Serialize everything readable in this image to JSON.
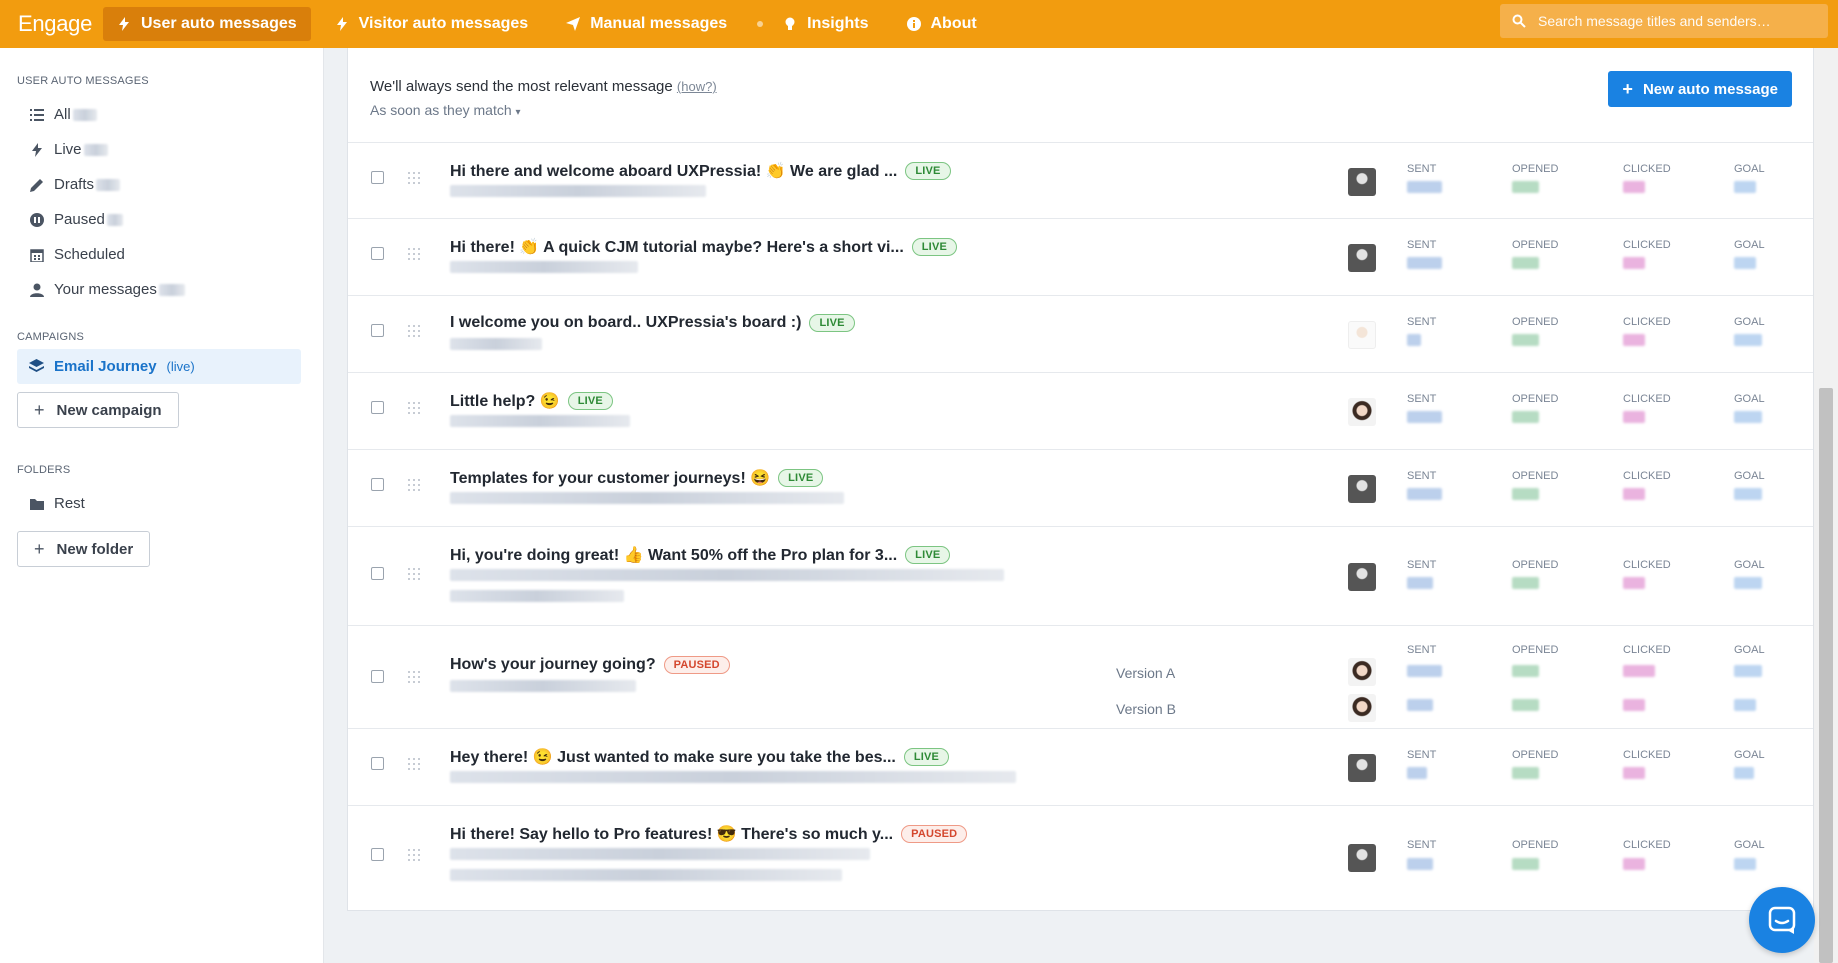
{
  "app": {
    "brand": "Engage"
  },
  "nav": {
    "items": [
      {
        "label": "User auto messages",
        "icon": "bolt-icon",
        "active": true
      },
      {
        "label": "Visitor auto messages",
        "icon": "bolt-icon",
        "active": false
      },
      {
        "label": "Manual messages",
        "icon": "paper-plane-icon",
        "active": false
      },
      {
        "label": "Insights",
        "icon": "lightbulb-icon",
        "active": false
      },
      {
        "label": "About",
        "icon": "info-icon",
        "active": false
      }
    ]
  },
  "search": {
    "placeholder": "Search message titles and senders…"
  },
  "sidebar": {
    "user_auto_heading": "USER AUTO MESSAGES",
    "items": [
      {
        "label": "All",
        "icon": "list-icon"
      },
      {
        "label": "Live",
        "icon": "bolt-icon"
      },
      {
        "label": "Drafts",
        "icon": "pencil-icon"
      },
      {
        "label": "Paused",
        "icon": "pause-icon"
      },
      {
        "label": "Scheduled",
        "icon": "calendar-icon"
      },
      {
        "label": "Your messages",
        "icon": "user-icon"
      }
    ],
    "campaigns_heading": "CAMPAIGNS",
    "campaign": {
      "name": "Email Journey",
      "status": "(live)"
    },
    "new_campaign": "New campaign",
    "folders_heading": "FOLDERS",
    "folder": {
      "label": "Rest"
    },
    "new_folder": "New folder"
  },
  "main": {
    "header_title": "We'll always send the most relevant message",
    "header_link": "(how?)",
    "header_sub": "As soon as they match",
    "new_button": "New auto message",
    "stat_labels": {
      "sent": "SENT",
      "opened": "OPENED",
      "clicked": "CLICKED",
      "goal": "GOAL"
    },
    "messages": [
      {
        "title": "Hi there and welcome aboard UXPressia! 👏 We are glad ...",
        "status": "LIVE"
      },
      {
        "title": "Hi there! 👏 A quick CJM tutorial maybe? Here's a short vi...",
        "status": "LIVE"
      },
      {
        "title": "I welcome you on board.. UXPressia's board :)",
        "status": "LIVE"
      },
      {
        "title": "Little help? 😉",
        "status": "LIVE"
      },
      {
        "title": "Templates for your customer journeys! 😆",
        "status": "LIVE"
      },
      {
        "title": "Hi, you're doing great! 👍 Want 50% off the Pro plan for 3...",
        "status": "LIVE"
      },
      {
        "title": "How's your journey going?",
        "status": "PAUSED",
        "versions": [
          "Version A",
          "Version B"
        ]
      },
      {
        "title": "Hey there! 😉 Just wanted to make sure you take the bes...",
        "status": "LIVE"
      },
      {
        "title": "Hi there! Say hello to Pro features! 😎  There's so much y...",
        "status": "PAUSED"
      }
    ]
  }
}
